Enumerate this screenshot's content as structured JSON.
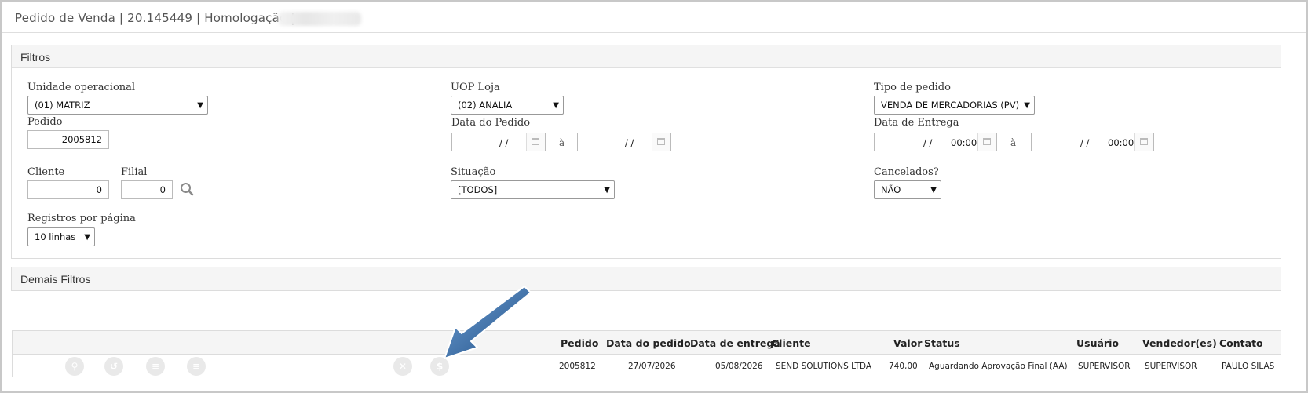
{
  "header": {
    "title": "Pedido de Venda | 20.145449 | Homologação |"
  },
  "filtros": {
    "title": "Filtros",
    "unidade": {
      "label": "Unidade operacional",
      "value": "(01) MATRIZ"
    },
    "uop": {
      "label": "UOP Loja",
      "value": "(02) ANALIA"
    },
    "tipo": {
      "label": "Tipo de pedido",
      "value": "VENDA DE MERCADORIAS (PV)"
    },
    "pedido": {
      "label": "Pedido",
      "value": "2005812"
    },
    "data_pedido": {
      "label": "Data do Pedido",
      "from": "/ /",
      "to": "/ /",
      "sep": "à"
    },
    "data_entrega": {
      "label": "Data de Entrega",
      "from_date": "/ /",
      "from_time": "00:00",
      "to_date": "/ /",
      "to_time": "00:00",
      "sep": "à"
    },
    "cliente": {
      "label": "Cliente",
      "value": "0"
    },
    "filial": {
      "label": "Filial",
      "value": "0"
    },
    "situacao": {
      "label": "Situação",
      "value": "[TODOS]"
    },
    "cancelados": {
      "label": "Cancelados?",
      "value": "NÃO"
    },
    "registros": {
      "label": "Registros por página",
      "value": "10 linhas"
    }
  },
  "demais": {
    "title": "Demais Filtros"
  },
  "grid": {
    "columns": [
      "Pedido",
      "Data do pedido",
      "Data de entrega",
      "Cliente",
      "Valor",
      "Status",
      "Usuário",
      "Vendedor(es)",
      "Contato"
    ],
    "rows": [
      {
        "pedido": "2005812",
        "data_pedido": "27/07/2026",
        "data_entrega": "05/08/2026",
        "cliente": "SEND SOLUTIONS LTDA",
        "valor": "740,00",
        "status": "Aguardando Aprovação Final (AA)",
        "usuario": "SUPERVISOR",
        "vendedor": "SUPERVISOR",
        "contato": "PAULO SILAS"
      }
    ]
  },
  "colors": {
    "accent_arrow": "#1f4f86",
    "header_bg": "#f5f5f5"
  }
}
